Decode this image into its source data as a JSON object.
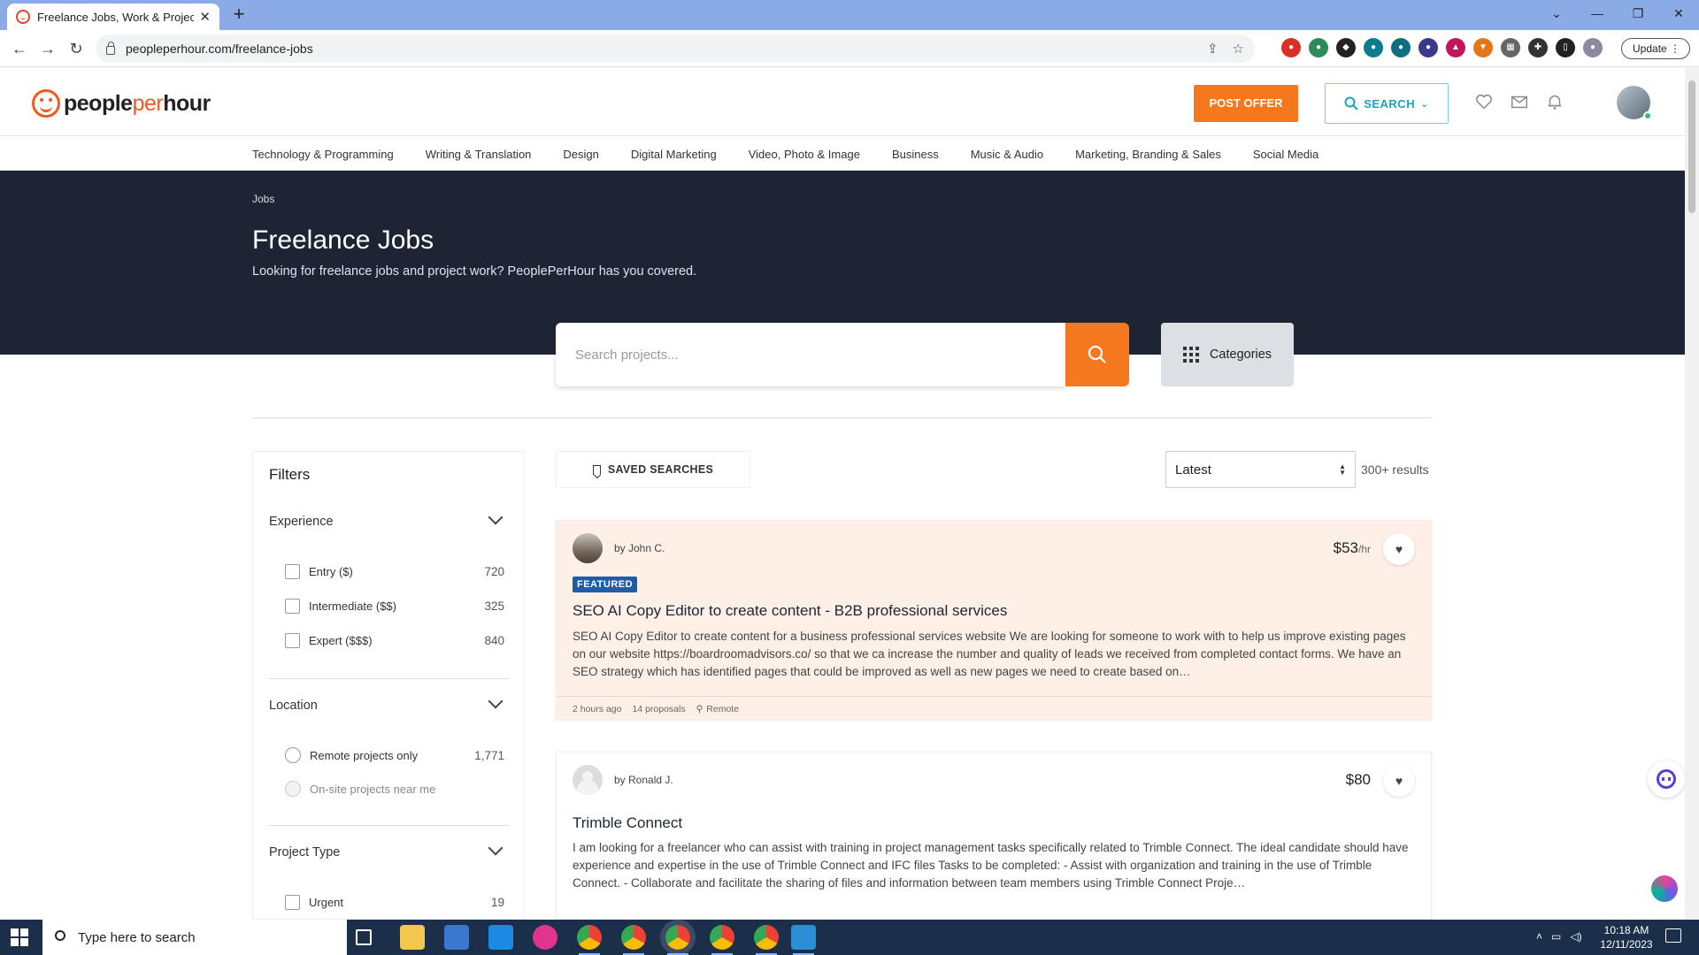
{
  "browser": {
    "tab_title": "Freelance Jobs, Work & Projects",
    "url": "peopleperhour.com/freelance-jobs",
    "update_label": "Update"
  },
  "site": {
    "logo_people": "people",
    "logo_per": "per",
    "logo_hour": "hour",
    "post_offer": "POST OFFER",
    "search_label": "SEARCH",
    "accent": "#f5781e",
    "brand_dark": "#1d2433"
  },
  "categories": [
    "Technology & Programming",
    "Writing & Translation",
    "Design",
    "Digital Marketing",
    "Video, Photo & Image",
    "Business",
    "Music & Audio",
    "Marketing, Branding & Sales",
    "Social Media"
  ],
  "hero": {
    "breadcrumb": "Jobs",
    "title": "Freelance Jobs",
    "subtitle": "Looking for freelance jobs and project work? PeoplePerHour has you covered.",
    "search_placeholder": "Search projects...",
    "categories_button": "Categories"
  },
  "filters": {
    "title": "Filters",
    "experience": {
      "title": "Experience",
      "options": [
        {
          "label": "Entry ($)",
          "count": "720"
        },
        {
          "label": "Intermediate ($$)",
          "count": "325"
        },
        {
          "label": "Expert ($$$)",
          "count": "840"
        }
      ]
    },
    "location": {
      "title": "Location",
      "options": [
        {
          "label": "Remote projects only",
          "count": "1,771"
        },
        {
          "label": "On-site projects near me",
          "count": ""
        }
      ]
    },
    "project_type": {
      "title": "Project Type",
      "options": [
        {
          "label": "Urgent",
          "count": "19"
        }
      ]
    }
  },
  "results": {
    "saved_searches": "SAVED SEARCHES",
    "sort_selected": "Latest",
    "count": "300+ results",
    "jobs": [
      {
        "by": "by John C.",
        "price": "$53",
        "price_unit": "/hr",
        "badge": "FEATURED",
        "title": "SEO AI Copy Editor to create content - B2B professional services",
        "description": "SEO AI Copy Editor to create content for a business professional services website We are looking for someone to work with to help us improve existing pages on our website https://boardroomadvisors.co/ so that we ca increase the number and quality of leads we received from completed contact forms. We have an SEO strategy which has identified pages that could be improved as well as new pages we need to create based on…",
        "posted": "2 hours ago",
        "proposals": "14 proposals",
        "location": "Remote"
      },
      {
        "by": "by Ronald J.",
        "price": "$80",
        "price_unit": "",
        "badge": "",
        "title": "Trimble Connect",
        "description": "I am looking for a freelancer who can assist with training in project management tasks specifically related to Trimble Connect. The ideal candidate should have experience and expertise in the use of Trimble Connect and IFC files Tasks to be completed: - Assist with organization and training in the use of Trimble Connect. - Collaborate and facilitate the sharing of files and information between team members using Trimble Connect Proje…",
        "posted": "",
        "proposals": "",
        "location": ""
      }
    ]
  },
  "taskbar": {
    "search_placeholder": "Type here to search",
    "time": "10:18 AM",
    "date": "12/11/2023"
  }
}
